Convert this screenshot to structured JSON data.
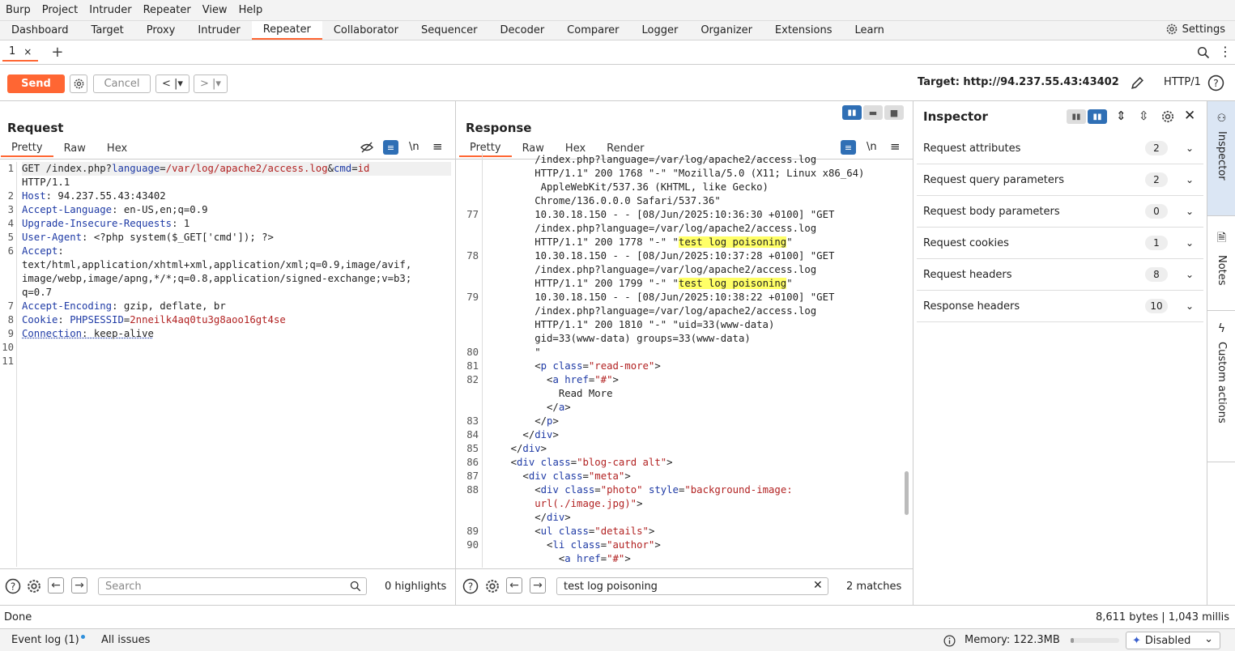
{
  "menu": [
    "Burp",
    "Project",
    "Intruder",
    "Repeater",
    "View",
    "Help"
  ],
  "tabs": [
    "Dashboard",
    "Target",
    "Proxy",
    "Intruder",
    "Repeater",
    "Collaborator",
    "Sequencer",
    "Decoder",
    "Comparer",
    "Logger",
    "Organizer",
    "Extensions",
    "Learn"
  ],
  "settings_label": "Settings",
  "subtab": {
    "label": "1",
    "close": "×",
    "add": "+"
  },
  "toolbar": {
    "send": "Send",
    "cancel": "Cancel",
    "target": "Target: http://94.237.55.43:43402",
    "http_version": "HTTP/1"
  },
  "request": {
    "title": "Request",
    "views": [
      "Pretty",
      "Raw",
      "Hex"
    ],
    "search_placeholder": "Search",
    "highlights": "0 highlights",
    "line_numbers": [
      "1",
      "",
      "2",
      "3",
      "4",
      "5",
      "6",
      "",
      "",
      "",
      "7",
      "8",
      "9",
      "10",
      "11"
    ]
  },
  "response": {
    "title": "Response",
    "views": [
      "Pretty",
      "Raw",
      "Hex",
      "Render"
    ],
    "search_value": "test log poisoning",
    "matches": "2 matches",
    "line_numbers": [
      "",
      "",
      "",
      "",
      "77",
      "",
      "",
      "78",
      "",
      "",
      "79",
      "",
      "",
      "",
      "80",
      "81",
      "82",
      "",
      "",
      "83",
      "84",
      "85",
      "86",
      "87",
      "88",
      "",
      "",
      "89",
      "90",
      ""
    ]
  },
  "inspector": {
    "title": "Inspector",
    "rows": [
      {
        "label": "Request attributes",
        "count": "2"
      },
      {
        "label": "Request query parameters",
        "count": "2"
      },
      {
        "label": "Request body parameters",
        "count": "0"
      },
      {
        "label": "Request cookies",
        "count": "1"
      },
      {
        "label": "Request headers",
        "count": "8"
      },
      {
        "label": "Response headers",
        "count": "10"
      }
    ]
  },
  "sidebar": {
    "inspector": "Inspector",
    "notes": "Notes",
    "custom_actions": "Custom actions"
  },
  "status": {
    "left": "Done",
    "right": "8,611 bytes | 1,043 millis"
  },
  "footer": {
    "event_log": "Event log (1)",
    "all_issues": "All issues",
    "memory": "Memory: 122.3MB",
    "ai": "Disabled"
  },
  "colors": {
    "accent": "#ff6633",
    "keyword": "#1e3aa5",
    "value": "#b22222",
    "highlight": "#ffff66"
  }
}
